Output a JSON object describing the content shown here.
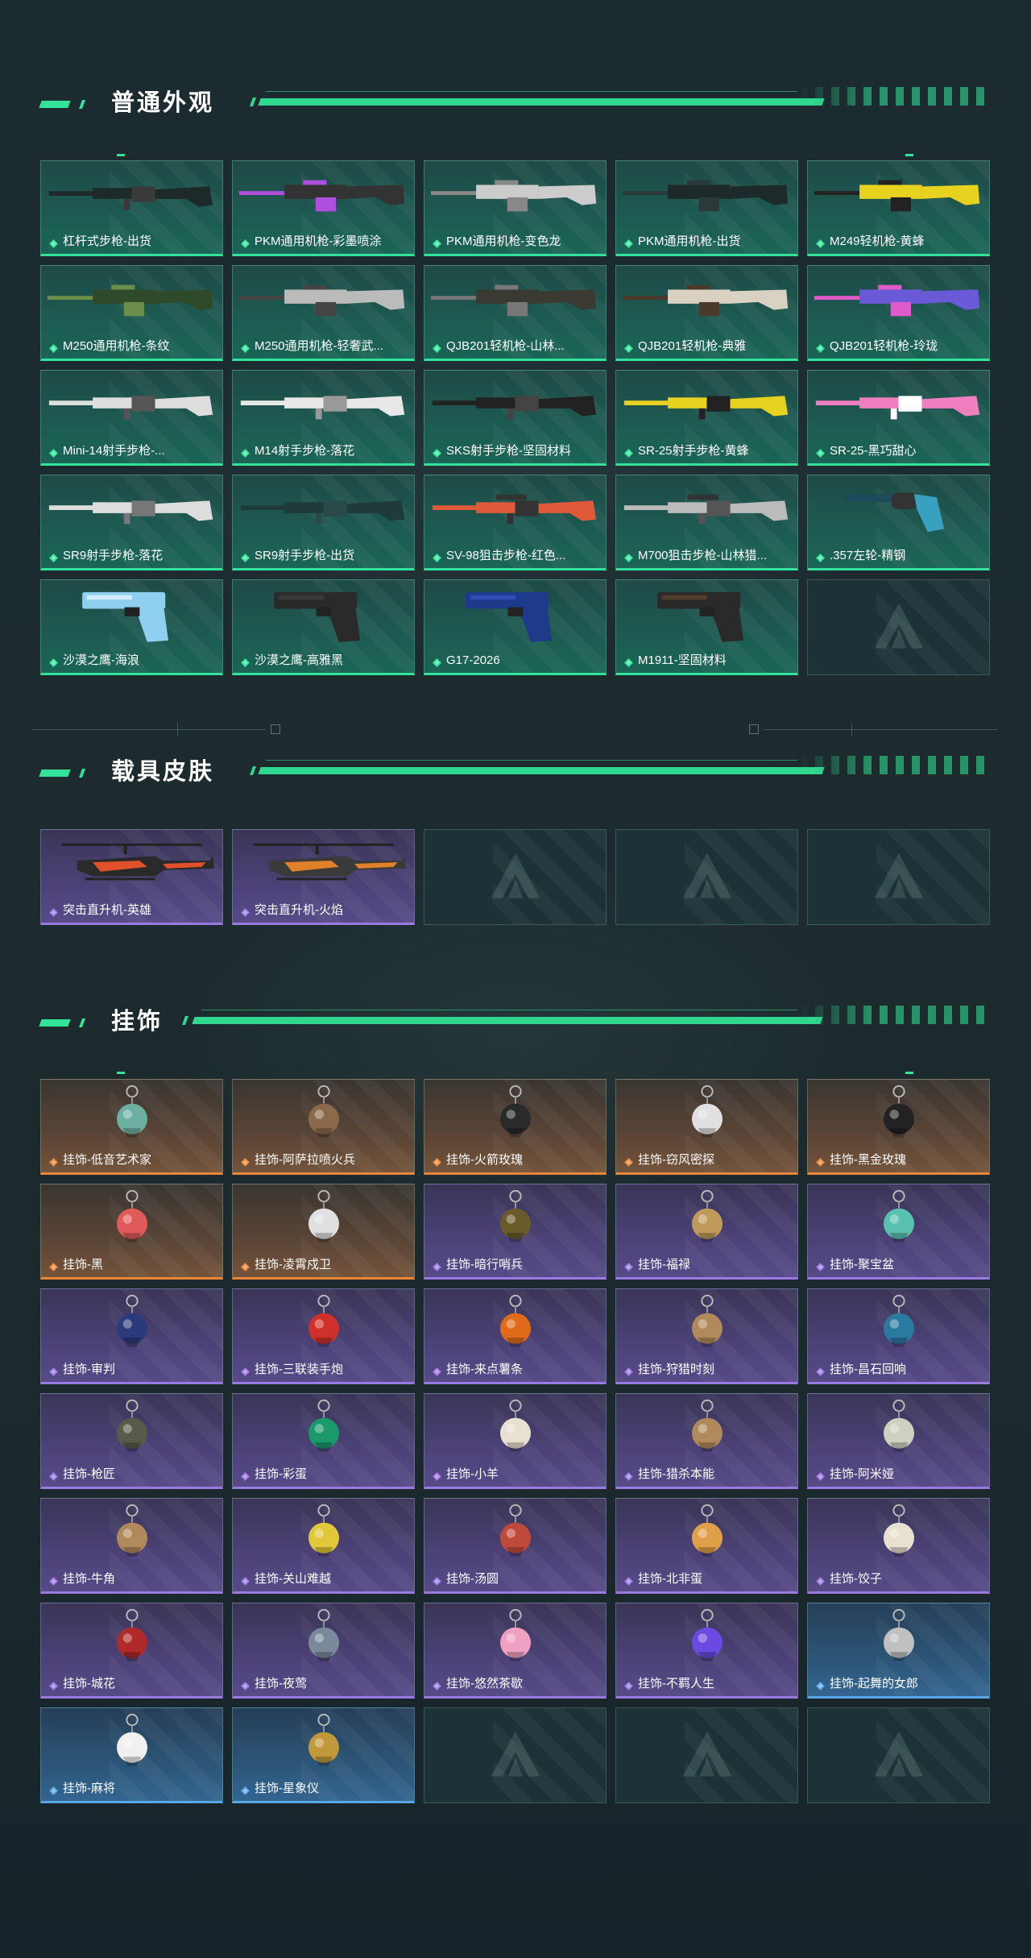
{
  "sections": {
    "skins": {
      "title": "普通外观",
      "items": [
        {
          "label": "杠杆式步枪-出货",
          "pic": "rifle",
          "color": "#1e2a2a",
          "accent": "#3a3a3a"
        },
        {
          "label": "PKM通用机枪-彩墨喷涂",
          "pic": "lmg",
          "color": "#333",
          "accent": "#b04ee0"
        },
        {
          "label": "PKM通用机枪-变色龙",
          "pic": "lmg",
          "color": "#ccc",
          "accent": "#888"
        },
        {
          "label": "PKM通用机枪-出货",
          "pic": "lmg",
          "color": "#1e2a2a",
          "accent": "#2a3a3a"
        },
        {
          "label": "M249轻机枪-黄蜂",
          "pic": "lmg",
          "color": "#e6d21f",
          "accent": "#222"
        },
        {
          "label": "M250通用机枪-条纹",
          "pic": "lmg",
          "color": "#2f4a2a",
          "accent": "#6b8e4a"
        },
        {
          "label": "M250通用机枪-轻奢武...",
          "pic": "lmg",
          "color": "#bbb",
          "accent": "#444"
        },
        {
          "label": "QJB201轻机枪-山林...",
          "pic": "lmg",
          "color": "#3a3a33",
          "accent": "#777"
        },
        {
          "label": "QJB201轻机枪-典雅",
          "pic": "lmg",
          "color": "#d9d2c2",
          "accent": "#4a3a2a"
        },
        {
          "label": "QJB201轻机枪-玲珑",
          "pic": "lmg",
          "color": "#6a5ad8",
          "accent": "#e05acb"
        },
        {
          "label": "Mini-14射手步枪-...",
          "pic": "rifle",
          "color": "#ddd",
          "accent": "#555"
        },
        {
          "label": "M14射手步枪-落花",
          "pic": "rifle",
          "color": "#e8e8e8",
          "accent": "#999"
        },
        {
          "label": "SKS射手步枪-坚固材料",
          "pic": "rifle",
          "color": "#222",
          "accent": "#444"
        },
        {
          "label": "SR-25射手步枪-黄蜂",
          "pic": "rifle",
          "color": "#e6d21f",
          "accent": "#222"
        },
        {
          "label": "SR-25-黑巧甜心",
          "pic": "rifle",
          "color": "#f07fc0",
          "accent": "#fff"
        },
        {
          "label": "SR9射手步枪-落花",
          "pic": "rifle",
          "color": "#ddd",
          "accent": "#777"
        },
        {
          "label": "SR9射手步枪-出货",
          "pic": "rifle",
          "color": "#1f3a3a",
          "accent": "#2a4a4a"
        },
        {
          "label": "SV-98狙击步枪-红色...",
          "pic": "sniper",
          "color": "#e05a3a",
          "accent": "#333"
        },
        {
          "label": "M700狙击步枪-山林猎...",
          "pic": "sniper",
          "color": "#bbb",
          "accent": "#555"
        },
        {
          "label": ".357左轮-精钢",
          "pic": "revolver",
          "color": "#1f4a5a",
          "accent": "#3aa0c0"
        },
        {
          "label": "沙漠之鹰-海浪",
          "pic": "pistol",
          "color": "#8fd0f0",
          "accent": "#ffffff"
        },
        {
          "label": "沙漠之鹰-高雅黑",
          "pic": "pistol",
          "color": "#2a2a2a",
          "accent": "#444"
        },
        {
          "label": "G17-2026",
          "pic": "pistol",
          "color": "#1e3a8a",
          "accent": "#3a5ad0"
        },
        {
          "label": "M1911-坚固材料",
          "pic": "pistol",
          "color": "#2a2a2a",
          "accent": "#6b4a2a"
        },
        {
          "label": "",
          "pic": "empty"
        }
      ]
    },
    "vehicles": {
      "title": "载具皮肤",
      "items": [
        {
          "label": "突击直升机-英雄",
          "pic": "heli",
          "color": "#2a2a2a",
          "accent": "#e0502a"
        },
        {
          "label": "突击直升机-火焰",
          "pic": "heli",
          "color": "#3a3a3a",
          "accent": "#e0802a"
        },
        {
          "label": "",
          "pic": "empty"
        },
        {
          "label": "",
          "pic": "empty"
        },
        {
          "label": "",
          "pic": "empty"
        }
      ]
    },
    "charms": {
      "title": "挂饰",
      "items": [
        {
          "label": "挂饰-低音艺术家",
          "tier": "orange",
          "color": "#6bb0a0"
        },
        {
          "label": "挂饰-阿萨拉喷火兵",
          "tier": "orange",
          "color": "#8a6a4a"
        },
        {
          "label": "挂饰-火箭玫瑰",
          "tier": "orange",
          "color": "#2a2a2a"
        },
        {
          "label": "挂饰-窃风密探",
          "tier": "orange",
          "color": "#e0e0e0"
        },
        {
          "label": "挂饰-黑金玫瑰",
          "tier": "orange",
          "color": "#222"
        },
        {
          "label": "挂饰-黑",
          "tier": "orange",
          "color": "#e05a5a"
        },
        {
          "label": "挂饰-凌霄戍卫",
          "tier": "orange",
          "color": "#e0e0e0"
        },
        {
          "label": "挂饰-暗行哨兵",
          "tier": "purple",
          "color": "#6b5a2a"
        },
        {
          "label": "挂饰-福禄",
          "tier": "purple",
          "color": "#c09a5a"
        },
        {
          "label": "挂饰-聚宝盆",
          "tier": "purple",
          "color": "#5ac0b0"
        },
        {
          "label": "挂饰-审判",
          "tier": "purple",
          "color": "#2a3a7a"
        },
        {
          "label": "挂饰-三联装手炮",
          "tier": "purple",
          "color": "#d0302a"
        },
        {
          "label": "挂饰-来点薯条",
          "tier": "purple",
          "color": "#e06a1a"
        },
        {
          "label": "挂饰-狩猎时刻",
          "tier": "purple",
          "color": "#b08a5a"
        },
        {
          "label": "挂饰-昌石回响",
          "tier": "purple",
          "color": "#2a7aa0"
        },
        {
          "label": "挂饰-枪匠",
          "tier": "purple",
          "color": "#5a5a4a"
        },
        {
          "label": "挂饰-彩蛋",
          "tier": "purple",
          "color": "#1a9a6a"
        },
        {
          "label": "挂饰-小羊",
          "tier": "purple",
          "color": "#e8e0d0"
        },
        {
          "label": "挂饰-猎杀本能",
          "tier": "purple",
          "color": "#b08a5a"
        },
        {
          "label": "挂饰-阿米娅",
          "tier": "purple",
          "color": "#d0d0c0"
        },
        {
          "label": "挂饰-牛角",
          "tier": "purple",
          "color": "#b08a5a"
        },
        {
          "label": "挂饰-关山难越",
          "tier": "purple",
          "color": "#e0c83a"
        },
        {
          "label": "挂饰-汤圆",
          "tier": "purple",
          "color": "#c04a3a"
        },
        {
          "label": "挂饰-北非蛋",
          "tier": "purple",
          "color": "#e0a04a"
        },
        {
          "label": "挂饰-饺子",
          "tier": "purple",
          "color": "#e8e0d0"
        },
        {
          "label": "挂饰-城花",
          "tier": "purple",
          "color": "#b02a2a"
        },
        {
          "label": "挂饰-夜莺",
          "tier": "purple",
          "color": "#7a8a9a"
        },
        {
          "label": "挂饰-悠然茶歇",
          "tier": "purple",
          "color": "#f0a0c0"
        },
        {
          "label": "挂饰-不羁人生",
          "tier": "purple",
          "color": "#6a4ae0"
        },
        {
          "label": "挂饰-起舞的女郎",
          "tier": "blue",
          "color": "#c0c0c0"
        },
        {
          "label": "挂饰-麻将",
          "tier": "blue",
          "color": "#f0f0f0"
        },
        {
          "label": "挂饰-星象仪",
          "tier": "blue",
          "color": "#c09a3a"
        },
        {
          "label": "",
          "tier": "empty"
        },
        {
          "label": "",
          "tier": "empty"
        },
        {
          "label": "",
          "tier": "empty"
        }
      ]
    }
  },
  "colors": {
    "accent_green": "#34e39a",
    "tier_green": "#34e39a",
    "tier_purple": "#9a7ae0",
    "tier_orange": "#e8873a",
    "tier_blue": "#58a8e8"
  }
}
